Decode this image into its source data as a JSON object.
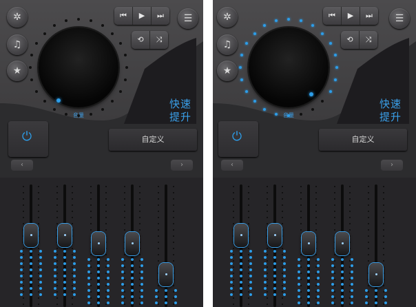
{
  "panels": [
    {
      "id": "left",
      "knob_state": "low",
      "accent": "#2d9de8"
    },
    {
      "id": "right",
      "knob_state": "high",
      "accent": "#2d9de8"
    }
  ],
  "buttons": {
    "share_icon": "share-icon",
    "music_icon": "music-icon",
    "star_icon": "star-icon",
    "list_icon": "list-icon",
    "prev_glyph": "⏮",
    "play_glyph": "▶",
    "next_glyph": "⏭",
    "repeat_glyph": "⟲",
    "shuffle_glyph": "⤨"
  },
  "labels": {
    "volume": "音量",
    "fast_up_line1": "快速",
    "fast_up_line2": "提升",
    "custom": "自定义",
    "power_glyph": "⏻",
    "arrow_left": "‹",
    "arrow_right": "›"
  },
  "equalizer": {
    "left_levels": [
      0.62,
      0.62,
      0.54,
      0.54,
      0.24
    ],
    "right_levels": [
      0.62,
      0.62,
      0.54,
      0.54,
      0.24
    ]
  },
  "colors": {
    "accent": "#2d9de8",
    "background": "#2c2c2e"
  }
}
